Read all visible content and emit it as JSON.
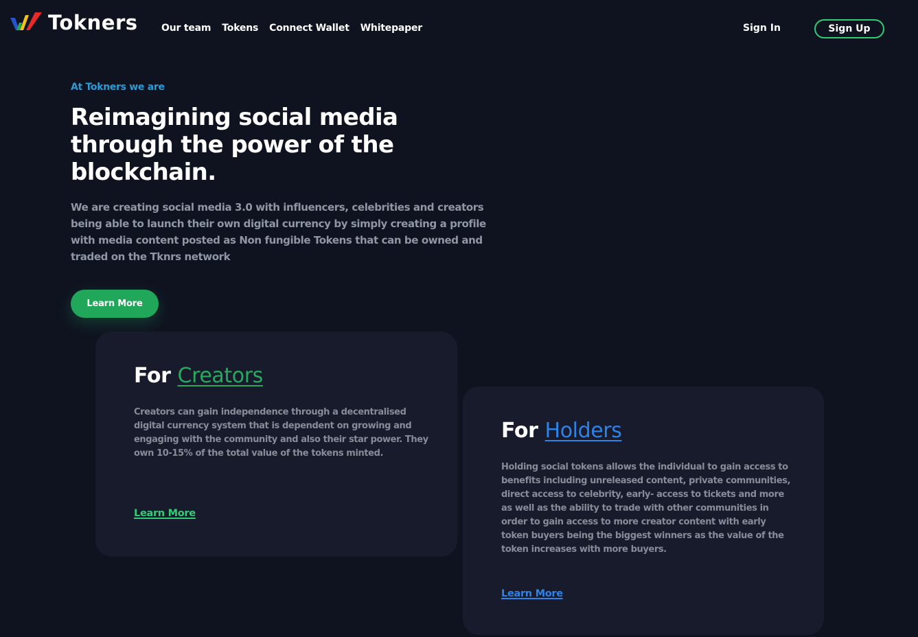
{
  "header": {
    "brand": "Tokners",
    "nav": [
      "Our team",
      "Tokens",
      "Connect Wallet",
      "Whitepaper"
    ],
    "sign_in": "Sign In",
    "sign_up": "Sign Up"
  },
  "hero": {
    "eyebrow": "At Tokners we are",
    "title": "Reimagining social media through the power of the blockchain.",
    "description": "We are creating social media 3.0 with influencers, celebrities and creators being able to launch their own digital currency by simply creating a profile with media content posted as Non fungible Tokens that can be owned and traded on the Tknrs network",
    "cta": "Learn More"
  },
  "cards": {
    "creators": {
      "title_prefix": "For",
      "title_accent": "Creators",
      "body": "Creators can gain independence through a decentralised digital currency system that is dependent on growing and engaging with the community and also their star power. They own 10-15% of the total value of the tokens minted.",
      "link": "Learn More"
    },
    "holders": {
      "title_prefix": "For",
      "title_accent": "Holders",
      "body": "Holding social tokens allows the individual to gain access to benefits including unreleased content, private communities, direct access to celebrity, early- access to tickets and more as well as the ability to trade with other communities in order to gain access to more creator content with early token buyers being the biggest winners as the value of the token increases with more buyers.",
      "link": "Learn More"
    }
  },
  "colors": {
    "background": "#0f1320",
    "card": "#181b2b",
    "green": "#21a75a",
    "green_bright": "#2fce75",
    "blue": "#2f82e6",
    "eyebrow": "#2b9bd6",
    "muted_text": "#9096a3"
  }
}
